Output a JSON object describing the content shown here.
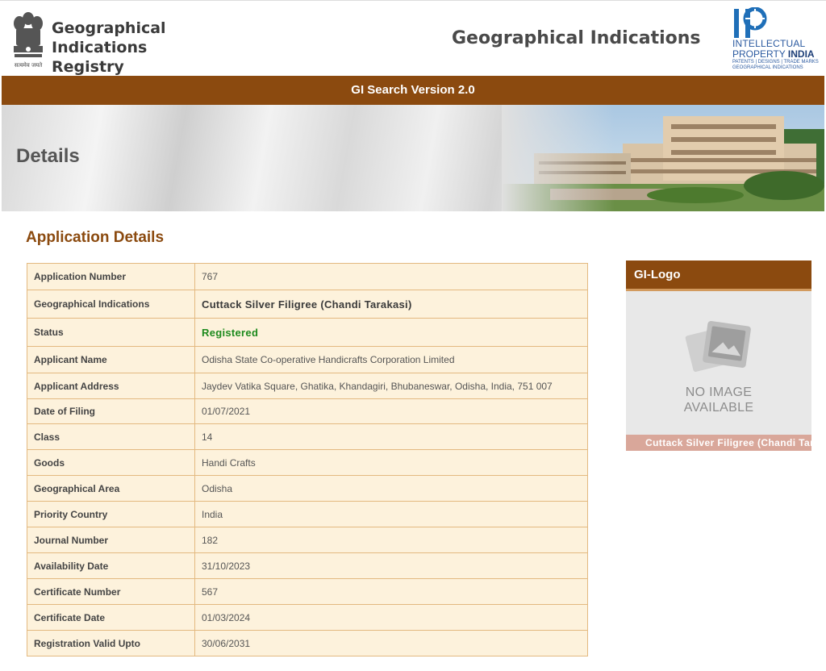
{
  "header": {
    "registry_line1": "Geographical Indications",
    "registry_line2": "Registry",
    "emblem_motto": "सत्यमेव जयते",
    "center_title": "Geographical Indications",
    "ipi": {
      "line1": "INTELLECTUAL",
      "line2a": "PROPERTY ",
      "line2b": "INDIA",
      "line3": "PATENTS | DESIGNS | TRADE MARKS",
      "line4": "GEOGRAPHICAL INDICATIONS"
    }
  },
  "version_bar": {
    "text": "GI Search Version 2.0"
  },
  "banner": {
    "title": "Details"
  },
  "section": {
    "title": "Application Details"
  },
  "details": [
    {
      "label": "Application Number",
      "value": "767",
      "style": "normal"
    },
    {
      "label": "Geographical Indications",
      "value": "Cuttack Silver Filigree (Chandi Tarakasi)",
      "style": "strong"
    },
    {
      "label": "Status",
      "value": "Registered",
      "style": "green"
    },
    {
      "label": "Applicant Name",
      "value": "Odisha State Co-operative Handicrafts Corporation Limited",
      "style": "normal"
    },
    {
      "label": "Applicant Address",
      "value": "Jaydev Vatika Square, Ghatika, Khandagiri, Bhubaneswar, Odisha, India, 751 007",
      "style": "normal"
    },
    {
      "label": "Date of Filing",
      "value": "01/07/2021",
      "style": "normal"
    },
    {
      "label": "Class",
      "value": "14",
      "style": "normal"
    },
    {
      "label": "Goods",
      "value": "Handi Crafts",
      "style": "normal"
    },
    {
      "label": "Geographical Area",
      "value": "Odisha",
      "style": "normal"
    },
    {
      "label": "Priority Country",
      "value": "India",
      "style": "normal"
    },
    {
      "label": "Journal Number",
      "value": "182",
      "style": "normal"
    },
    {
      "label": "Availability Date",
      "value": "31/10/2023",
      "style": "normal"
    },
    {
      "label": "Certificate Number",
      "value": "567",
      "style": "normal"
    },
    {
      "label": "Certificate Date",
      "value": "01/03/2024",
      "style": "normal"
    },
    {
      "label": "Registration Valid Upto",
      "value": "30/06/2031",
      "style": "normal"
    }
  ],
  "gi_logo": {
    "title": "GI-Logo",
    "no_image_line1": "NO IMAGE",
    "no_image_line2": "AVAILABLE",
    "caption": "Cuttack Silver Filigree (Chandi Tarakasi)"
  },
  "colors": {
    "brand_brown": "#8b4a0f",
    "table_bg": "#fdf2dc",
    "table_border": "#e3b980",
    "status_green": "#1d8a1d"
  }
}
